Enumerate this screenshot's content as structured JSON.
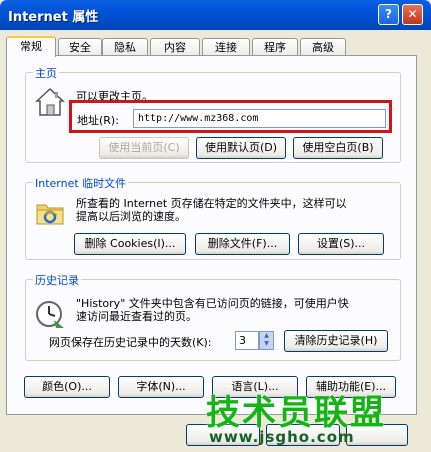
{
  "window": {
    "title": "Internet 属性",
    "help_symbol": "?",
    "close_symbol": "✕"
  },
  "tabs": [
    {
      "label": "常规",
      "active": true
    },
    {
      "label": "安全"
    },
    {
      "label": "隐私"
    },
    {
      "label": "内容"
    },
    {
      "label": "连接"
    },
    {
      "label": "程序"
    },
    {
      "label": "高级"
    }
  ],
  "homepage": {
    "group_title": "主页",
    "description": "可以更改主页。",
    "address_label": "地址(R):",
    "address_value": "http://www.mz368.com",
    "btn_current": "使用当前页(C)",
    "btn_default": "使用默认页(D)",
    "btn_blank": "使用空白页(B)",
    "icon": "home-page-icon"
  },
  "temp_files": {
    "group_title": "Internet 临时文件",
    "description_line1": "所查看的 Internet 页存储在特定的文件夹中，这样可以",
    "description_line2": "提高以后浏览的速度。",
    "btn_delete_cookies": "删除 Cookies(I)...",
    "btn_delete_files": "删除文件(F)...",
    "btn_settings": "设置(S)...",
    "icon": "ie-folder-icon"
  },
  "history": {
    "group_title": "历史记录",
    "description_line1": "\"History\" 文件夹中包含有已访问页的链接，可使用户快",
    "description_line2": "速访问最近查看过的页。",
    "days_label": "网页保存在历史记录中的天数(K):",
    "days_value": "3",
    "btn_clear": "清除历史记录(H)",
    "icon": "history-clock-icon"
  },
  "bottom_buttons": {
    "colors": "颜色(O)...",
    "fonts": "字体(N)...",
    "languages": "语言(L)...",
    "accessibility": "辅助功能(E)..."
  },
  "watermark": {
    "title": "技术员联盟",
    "url": "www.jsgho.com"
  }
}
